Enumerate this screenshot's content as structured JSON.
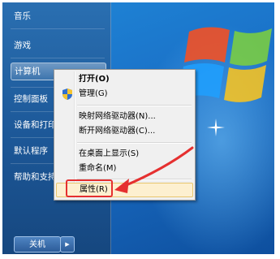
{
  "start_menu": {
    "items": [
      {
        "label": "音乐"
      },
      {
        "label": "游戏"
      },
      {
        "label": "计算机"
      },
      {
        "label": "控制面板"
      },
      {
        "label": "设备和打印机"
      },
      {
        "label": "默认程序"
      },
      {
        "label": "帮助和支持"
      }
    ],
    "shutdown_label": "关机",
    "shutdown_arrow": "▶"
  },
  "context_menu": {
    "items": [
      {
        "label": "打开(O)"
      },
      {
        "label": "管理(G)"
      },
      {
        "label": "映射网络驱动器(N)..."
      },
      {
        "label": "断开网络驱动器(C)..."
      },
      {
        "label": "在桌面上显示(S)"
      },
      {
        "label": "重命名(M)"
      },
      {
        "label": "属性(R)"
      }
    ]
  },
  "colors": {
    "annotation": "#e53030",
    "desktop": "#1a6fc6",
    "start_panel": "#1c5797"
  },
  "icons": {
    "manage": "shield-icon",
    "desktop_logo": "windows-logo-icon",
    "annotation": "red-arrow-icon"
  }
}
